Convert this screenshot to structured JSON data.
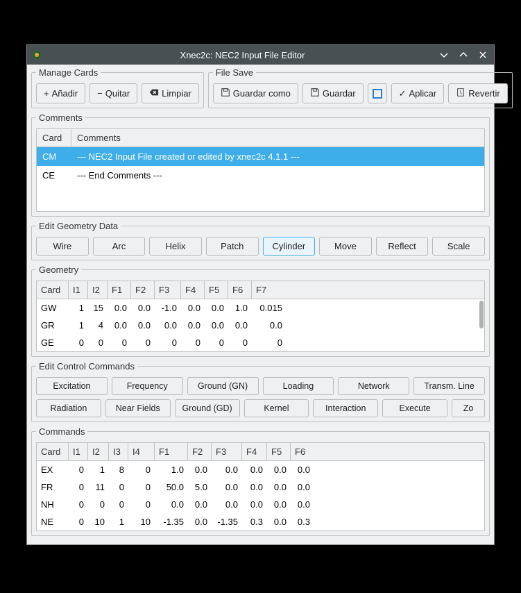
{
  "window": {
    "title": "Xnec2c: NEC2 Input File Editor"
  },
  "manageCards": {
    "legend": "Manage Cards",
    "add": "Añadir",
    "remove": "Quitar",
    "clear": "Limpiar"
  },
  "fileSave": {
    "legend": "File Save",
    "saveAs": "Guardar como",
    "save": "Guardar",
    "apply": "Aplicar",
    "revert": "Revertir"
  },
  "comments": {
    "legend": "Comments",
    "headers": {
      "card": "Card",
      "comment": "Comments"
    },
    "rows": [
      {
        "card": "CM",
        "text": "--- NEC2 Input File created or edited by xnec2c 4.1.1 ---",
        "selected": true
      },
      {
        "card": "CE",
        "text": "--- End Comments ---",
        "selected": false
      }
    ]
  },
  "editGeom": {
    "legend": "Edit Geometry Data",
    "buttons": [
      "Wire",
      "Arc",
      "Helix",
      "Patch",
      "Cylinder",
      "Move",
      "Reflect",
      "Scale"
    ],
    "active": "Cylinder"
  },
  "geometry": {
    "legend": "Geometry",
    "headers": [
      "Card",
      "I1",
      "I2",
      "F1",
      "F2",
      "F3",
      "F4",
      "F5",
      "F6",
      "F7"
    ],
    "rows": [
      {
        "cells": [
          "GW",
          "1",
          "15",
          "0.0",
          "0.0",
          "-1.0",
          "0.0",
          "0.0",
          "1.0",
          "0.015"
        ],
        "selected": false
      },
      {
        "cells": [
          "GR",
          "1",
          "4",
          "0.0",
          "0.0",
          "0.0",
          "0.0",
          "0.0",
          "0.0",
          "0.0"
        ],
        "selected": true
      },
      {
        "cells": [
          "GE",
          "0",
          "0",
          "0",
          "0",
          "0",
          "0",
          "0",
          "0",
          "0"
        ],
        "selected": false
      }
    ]
  },
  "editCtrl": {
    "legend": "Edit Control Commands",
    "row1": [
      "Excitation",
      "Frequency",
      "Ground (GN)",
      "Loading",
      "Network",
      "Transm. Line"
    ],
    "row2": [
      "Radiation",
      "Near Fields",
      "Ground (GD)",
      "Kernel",
      "Interaction",
      "Execute",
      "Zo"
    ]
  },
  "commands": {
    "legend": "Commands",
    "headers": [
      "Card",
      "I1",
      "I2",
      "I3",
      "I4",
      "F1",
      "F2",
      "F3",
      "F4",
      "F5",
      "F6"
    ],
    "rows": [
      {
        "cells": [
          "EX",
          "0",
          "1",
          "8",
          "0",
          "1.0",
          "0.0",
          "0.0",
          "0.0",
          "0.0",
          "0.0"
        ]
      },
      {
        "cells": [
          "FR",
          "0",
          "11",
          "0",
          "0",
          "50.0",
          "5.0",
          "0.0",
          "0.0",
          "0.0",
          "0.0"
        ]
      },
      {
        "cells": [
          "NH",
          "0",
          "0",
          "0",
          "0",
          "0.0",
          "0.0",
          "0.0",
          "0.0",
          "0.0",
          "0.0"
        ]
      },
      {
        "cells": [
          "NE",
          "0",
          "10",
          "1",
          "10",
          "-1.35",
          "0.0",
          "-1.35",
          "0.3",
          "0.0",
          "0.3"
        ]
      }
    ]
  }
}
